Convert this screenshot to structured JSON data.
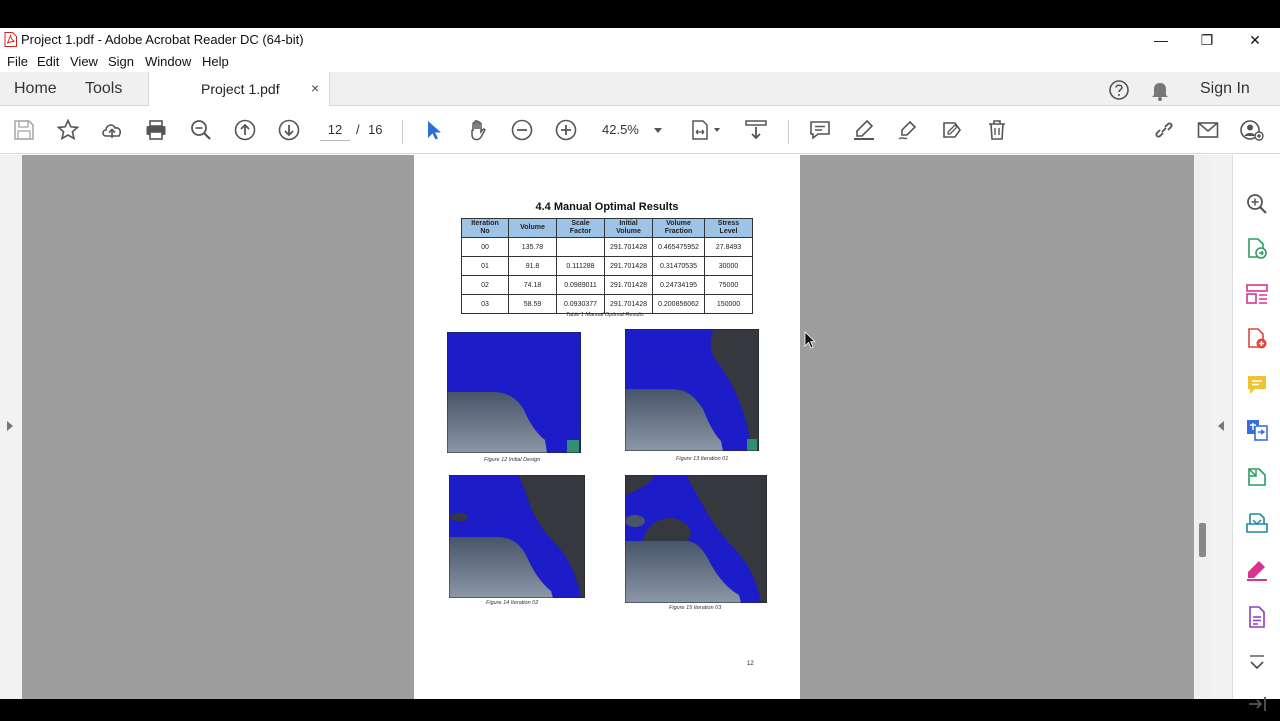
{
  "window": {
    "title": "Project 1.pdf - Adobe Acrobat Reader DC (64-bit)",
    "minimize": "—",
    "restore": "❐",
    "close": "✕"
  },
  "menu": [
    "File",
    "Edit",
    "View",
    "Sign",
    "Window",
    "Help"
  ],
  "tabs": {
    "home": "Home",
    "tools": "Tools",
    "document": "Project 1.pdf",
    "close": "×",
    "sign_in": "Sign In"
  },
  "toolbar": {
    "current_page": "12",
    "page_separator": "/",
    "total_pages": "16",
    "zoom": "42.5%",
    "icons": [
      "save-icon",
      "star-icon",
      "upload-icon",
      "print-icon",
      "zoom-out-search-icon",
      "page-up-icon",
      "page-down-icon",
      "select-arrow-icon",
      "hand-icon",
      "zoom-minus-icon",
      "zoom-plus-icon",
      "fit-page-icon",
      "scroll-mode-icon",
      "comment-icon",
      "highlight-icon",
      "draw-icon",
      "edit-sign-icon",
      "delete-icon",
      "link-icon",
      "email-icon",
      "share-user-icon"
    ]
  },
  "page": {
    "heading": "4.4 Manual Optimal Results",
    "table": {
      "headers": [
        [
          "Iteration",
          "No"
        ],
        [
          "Volume",
          ""
        ],
        [
          "Scale",
          "Factor"
        ],
        [
          "Initial",
          "Volume"
        ],
        [
          "Volume",
          "Fraction"
        ],
        [
          "Stress",
          "Level"
        ]
      ],
      "rows": [
        [
          "00",
          "135.78",
          "",
          "291.701428",
          "0.465475952",
          "27.8493"
        ],
        [
          "01",
          "91.8",
          "0.111288",
          "291.701428",
          "0.31470535",
          "30000"
        ],
        [
          "02",
          "74.18",
          "0.0989011",
          "291.701428",
          "0.24734195",
          "75000"
        ],
        [
          "03",
          "58.59",
          "0.0930377",
          "291.701428",
          "0.200856062",
          "150000"
        ]
      ],
      "caption": "Table 1 Manual Optimal Results"
    },
    "figures": [
      {
        "caption": "Figure 12 Initial Design"
      },
      {
        "caption": "Figure 13 Iteration 01"
      },
      {
        "caption": "Figure 14 Iteration 02"
      },
      {
        "caption": "Figure 15 Iteration 03"
      }
    ],
    "page_number": "12"
  },
  "sidebar_right": [
    "zoom-search-icon",
    "export-pdf-icon",
    "organize-pages-icon",
    "create-pdf-icon",
    "comment-icon",
    "convert-icon",
    "compress-icon",
    "send-for-review-icon",
    "fill-sign-icon",
    "edit-pdf-icon",
    "more-tools-chevron-icon",
    "collapse-panel-icon"
  ],
  "colors": {
    "mesh_blue": "#1c1cc8",
    "mesh_dark": "#35383f",
    "accent_blue": "#2d6fd6",
    "sidebar_green": "#2a9d5b",
    "sidebar_red": "#e0453a",
    "sidebar_pink": "#d8338f"
  }
}
